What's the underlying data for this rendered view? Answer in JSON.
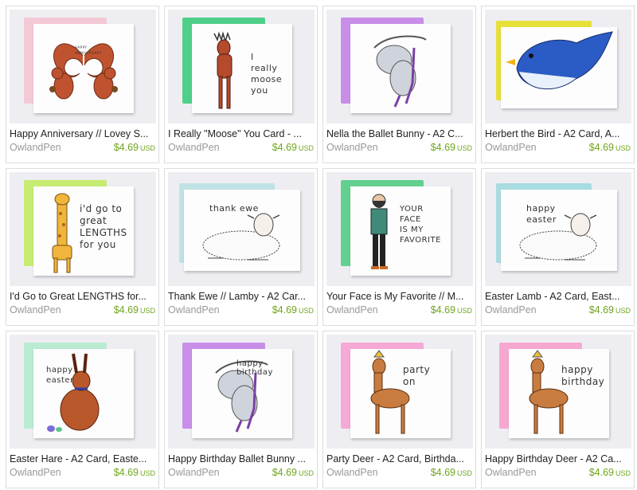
{
  "listings": [
    {
      "title": "Happy Anniversary // Lovey S...",
      "shop": "OwlandPen",
      "price": "$4.69",
      "currency": "USD",
      "envelope": "#f4c9d6",
      "art": "squirrels-illustration",
      "lines": [
        "HAPPY",
        "ANNIVERSARY"
      ]
    },
    {
      "title": "I Really \"Moose\" You Card - ...",
      "shop": "OwlandPen",
      "price": "$4.69",
      "currency": "USD",
      "envelope": "#4fd08a",
      "art": "moose-illustration",
      "lines": [
        "I",
        "really",
        "moose",
        "you"
      ]
    },
    {
      "title": "Nella the Ballet Bunny - A2 C...",
      "shop": "OwlandPen",
      "price": "$4.69",
      "currency": "USD",
      "envelope": "#c88ee8",
      "art": "ballet-bunny-illustration",
      "lines": []
    },
    {
      "title": "Herbert the Bird - A2 Card, A...",
      "shop": "OwlandPen",
      "price": "$4.69",
      "currency": "USD",
      "envelope": "#e8e03a",
      "art": "bluebird-illustration",
      "lines": []
    },
    {
      "title": "I'd Go to Great LENGTHS for...",
      "shop": "OwlandPen",
      "price": "$4.69",
      "currency": "USD",
      "envelope": "#c7ec72",
      "art": "giraffe-illustration",
      "lines": [
        "i'd go to",
        "great",
        "LENGTHS",
        "for you"
      ]
    },
    {
      "title": "Thank Ewe // Lamby - A2 Car...",
      "shop": "OwlandPen",
      "price": "$4.69",
      "currency": "USD",
      "envelope": "#bfe3e4",
      "art": "lamb-illustration",
      "lines": [
        "thank ewe"
      ]
    },
    {
      "title": "Your Face is My Favorite // M...",
      "shop": "OwlandPen",
      "price": "$4.69",
      "currency": "USD",
      "envelope": "#62d08e",
      "art": "bearded-man-illustration",
      "lines": [
        "YOUR",
        "FACE",
        "IS MY",
        "FAVORITE"
      ]
    },
    {
      "title": "Easter Lamb - A2 Card, East...",
      "shop": "OwlandPen",
      "price": "$4.69",
      "currency": "USD",
      "envelope": "#a8dce0",
      "art": "lamb-illustration",
      "lines": [
        "happy",
        "easter"
      ]
    },
    {
      "title": "Easter Hare - A2 Card, Easte...",
      "shop": "OwlandPen",
      "price": "$4.69",
      "currency": "USD",
      "envelope": "#b9ecd1",
      "art": "hare-illustration",
      "lines": [
        "happy",
        "easter"
      ]
    },
    {
      "title": "Happy Birthday Ballet Bunny ...",
      "shop": "OwlandPen",
      "price": "$4.69",
      "currency": "USD",
      "envelope": "#c88ee8",
      "art": "ballet-bunny-illustration",
      "lines": [
        "happy birthday"
      ]
    },
    {
      "title": "Party Deer - A2 Card, Birthda...",
      "shop": "OwlandPen",
      "price": "$4.69",
      "currency": "USD",
      "envelope": "#f6a8d6",
      "art": "party-deer-illustration",
      "lines": [
        "party",
        "on"
      ]
    },
    {
      "title": "Happy Birthday Deer - A2 Ca...",
      "shop": "OwlandPen",
      "price": "$4.69",
      "currency": "USD",
      "envelope": "#f6a8d0",
      "art": "party-deer-illustration",
      "lines": [
        "happy",
        "birthday"
      ]
    }
  ]
}
